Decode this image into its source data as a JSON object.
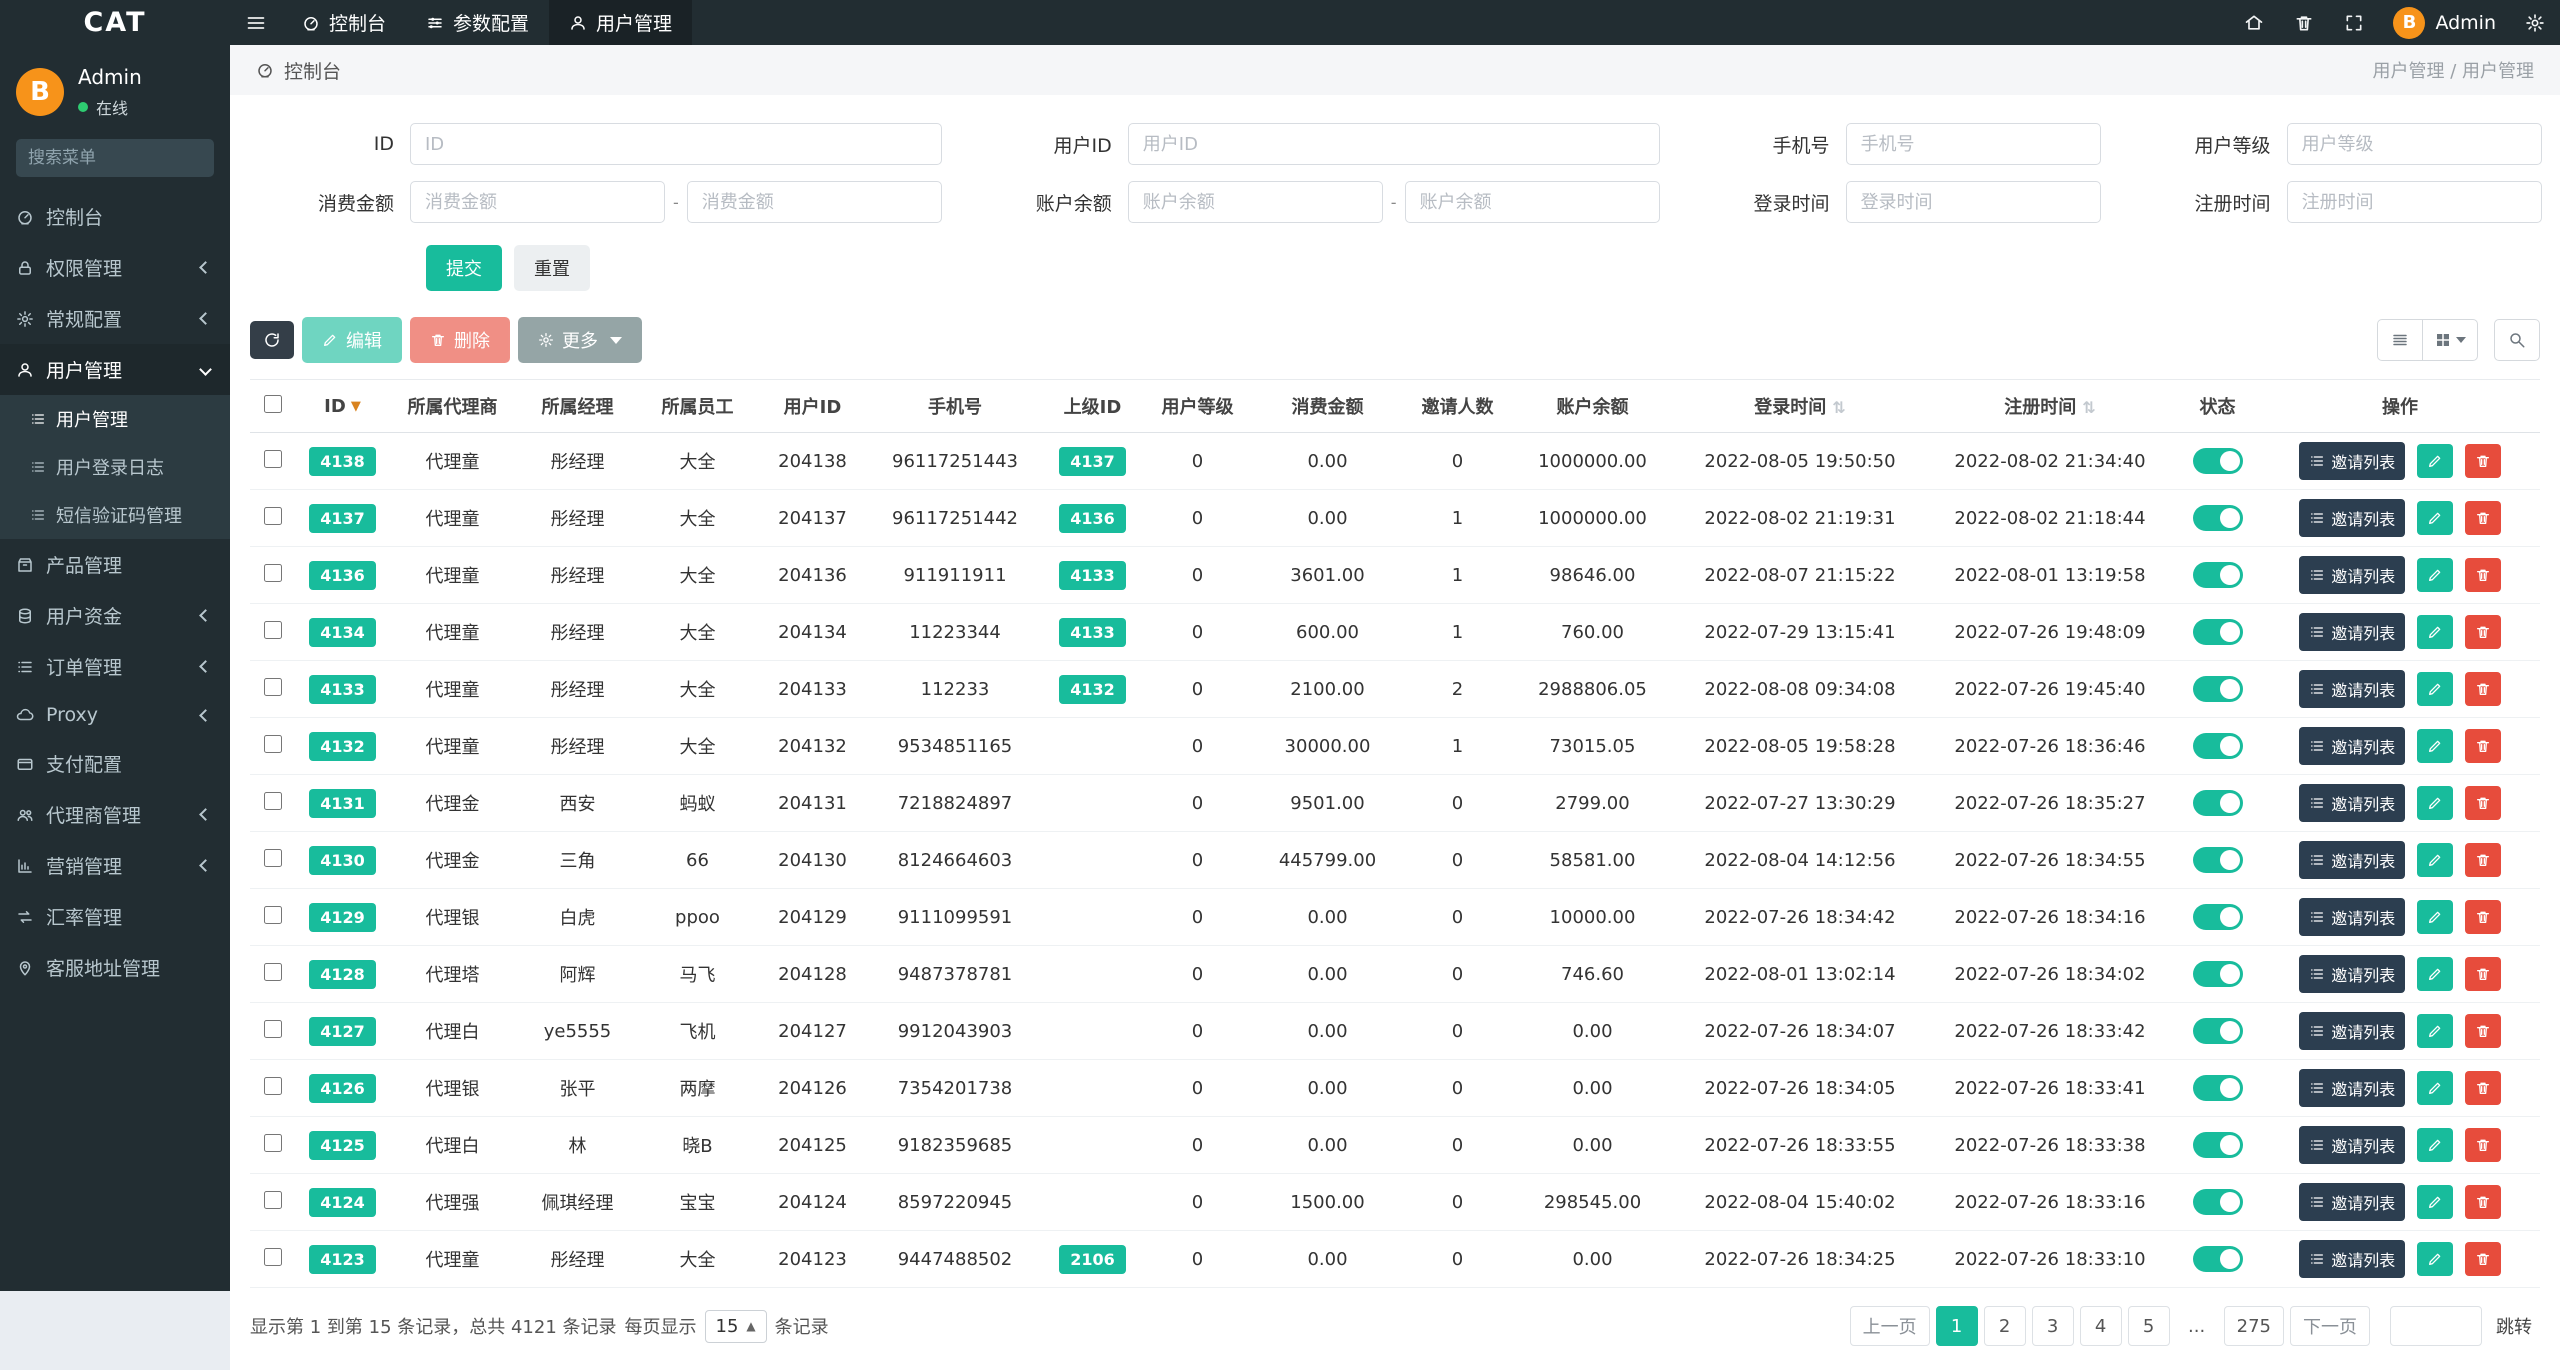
{
  "brand": "CAT",
  "topnav": {
    "items": [
      {
        "label": "控制台"
      },
      {
        "label": "参数配置"
      },
      {
        "label": "用户管理"
      }
    ],
    "admin_label": "Admin"
  },
  "sidebar": {
    "user_name": "Admin",
    "user_status": "在线",
    "avatar_letter": "B",
    "search_placeholder": "搜索菜单",
    "items": [
      {
        "label": "控制台",
        "icon": "gauge"
      },
      {
        "label": "权限管理",
        "icon": "lock",
        "arrow": "left"
      },
      {
        "label": "常规配置",
        "icon": "gear",
        "arrow": "left"
      },
      {
        "label": "用户管理",
        "icon": "user",
        "arrow": "down",
        "active": true,
        "children": [
          {
            "label": "用户管理",
            "active": true
          },
          {
            "label": "用户登录日志"
          },
          {
            "label": "短信验证码管理"
          }
        ]
      },
      {
        "label": "产品管理",
        "icon": "box"
      },
      {
        "label": "用户资金",
        "icon": "coins",
        "arrow": "left"
      },
      {
        "label": "订单管理",
        "icon": "list",
        "arrow": "left"
      },
      {
        "label": "Proxy",
        "icon": "cloud",
        "arrow": "left"
      },
      {
        "label": "支付配置",
        "icon": "card"
      },
      {
        "label": "代理商管理",
        "icon": "users",
        "arrow": "left"
      },
      {
        "label": "营销管理",
        "icon": "chart",
        "arrow": "left"
      },
      {
        "label": "汇率管理",
        "icon": "exchange"
      },
      {
        "label": "客服地址管理",
        "icon": "pin"
      }
    ]
  },
  "breadcrumb": {
    "left": "控制台",
    "right": "用户管理 / 用户管理"
  },
  "filters": {
    "row1": [
      {
        "label": "ID",
        "placeholder": "ID"
      },
      {
        "label": "用户ID",
        "placeholder": "用户ID"
      },
      {
        "label": "手机号",
        "placeholder": "手机号"
      },
      {
        "label": "用户等级",
        "placeholder": "用户等级"
      }
    ],
    "row2": [
      {
        "label": "消费金额",
        "placeholder": "消费金额"
      },
      {
        "label": "账户余额",
        "placeholder": "账户余额"
      },
      {
        "label": "登录时间",
        "placeholder": "登录时间"
      },
      {
        "label": "注册时间",
        "placeholder": "注册时间"
      }
    ],
    "submit_label": "提交",
    "reset_label": "重置"
  },
  "toolbar": {
    "edit_label": "编辑",
    "delete_label": "删除",
    "more_label": "更多"
  },
  "table": {
    "columns": [
      "ID",
      "所属代理商",
      "所属经理",
      "所属员工",
      "用户ID",
      "手机号",
      "上级ID",
      "用户等级",
      "消费金额",
      "邀请人数",
      "账户余额",
      "登录时间",
      "注册时间",
      "状态",
      "操作"
    ],
    "row_action_label": "邀请列表",
    "rows": [
      {
        "id": "4138",
        "agent": "代理童",
        "manager": "彤经理",
        "staff": "大全",
        "user_id": "204138",
        "phone": "96117251443",
        "parent_id": "4137",
        "level": "0",
        "consume": "0.00",
        "invites": "0",
        "balance": "1000000.00",
        "login_time": "2022-08-05 19:50:50",
        "reg_time": "2022-08-02 21:34:40"
      },
      {
        "id": "4137",
        "agent": "代理童",
        "manager": "彤经理",
        "staff": "大全",
        "user_id": "204137",
        "phone": "96117251442",
        "parent_id": "4136",
        "level": "0",
        "consume": "0.00",
        "invites": "1",
        "balance": "1000000.00",
        "login_time": "2022-08-02 21:19:31",
        "reg_time": "2022-08-02 21:18:44"
      },
      {
        "id": "4136",
        "agent": "代理童",
        "manager": "彤经理",
        "staff": "大全",
        "user_id": "204136",
        "phone": "911911911",
        "parent_id": "4133",
        "level": "0",
        "consume": "3601.00",
        "invites": "1",
        "balance": "98646.00",
        "login_time": "2022-08-07 21:15:22",
        "reg_time": "2022-08-01 13:19:58"
      },
      {
        "id": "4134",
        "agent": "代理童",
        "manager": "彤经理",
        "staff": "大全",
        "user_id": "204134",
        "phone": "11223344",
        "parent_id": "4133",
        "level": "0",
        "consume": "600.00",
        "invites": "1",
        "balance": "760.00",
        "login_time": "2022-07-29 13:15:41",
        "reg_time": "2022-07-26 19:48:09"
      },
      {
        "id": "4133",
        "agent": "代理童",
        "manager": "彤经理",
        "staff": "大全",
        "user_id": "204133",
        "phone": "112233",
        "parent_id": "4132",
        "level": "0",
        "consume": "2100.00",
        "invites": "2",
        "balance": "2988806.05",
        "login_time": "2022-08-08 09:34:08",
        "reg_time": "2022-07-26 19:45:40"
      },
      {
        "id": "4132",
        "agent": "代理童",
        "manager": "彤经理",
        "staff": "大全",
        "user_id": "204132",
        "phone": "9534851165",
        "parent_id": "",
        "level": "0",
        "consume": "30000.00",
        "invites": "1",
        "balance": "73015.05",
        "login_time": "2022-08-05 19:58:28",
        "reg_time": "2022-07-26 18:36:46"
      },
      {
        "id": "4131",
        "agent": "代理金",
        "manager": "西安",
        "staff": "蚂蚁",
        "user_id": "204131",
        "phone": "7218824897",
        "parent_id": "",
        "level": "0",
        "consume": "9501.00",
        "invites": "0",
        "balance": "2799.00",
        "login_time": "2022-07-27 13:30:29",
        "reg_time": "2022-07-26 18:35:27"
      },
      {
        "id": "4130",
        "agent": "代理金",
        "manager": "三角",
        "staff": "66",
        "user_id": "204130",
        "phone": "8124664603",
        "parent_id": "",
        "level": "0",
        "consume": "445799.00",
        "invites": "0",
        "balance": "58581.00",
        "login_time": "2022-08-04 14:12:56",
        "reg_time": "2022-07-26 18:34:55"
      },
      {
        "id": "4129",
        "agent": "代理银",
        "manager": "白虎",
        "staff": "ppoo",
        "user_id": "204129",
        "phone": "9111099591",
        "parent_id": "",
        "level": "0",
        "consume": "0.00",
        "invites": "0",
        "balance": "10000.00",
        "login_time": "2022-07-26 18:34:42",
        "reg_time": "2022-07-26 18:34:16"
      },
      {
        "id": "4128",
        "agent": "代理塔",
        "manager": "阿辉",
        "staff": "马飞",
        "user_id": "204128",
        "phone": "9487378781",
        "parent_id": "",
        "level": "0",
        "consume": "0.00",
        "invites": "0",
        "balance": "746.60",
        "login_time": "2022-08-01 13:02:14",
        "reg_time": "2022-07-26 18:34:02"
      },
      {
        "id": "4127",
        "agent": "代理白",
        "manager": "ye5555",
        "staff": "飞机",
        "user_id": "204127",
        "phone": "9912043903",
        "parent_id": "",
        "level": "0",
        "consume": "0.00",
        "invites": "0",
        "balance": "0.00",
        "login_time": "2022-07-26 18:34:07",
        "reg_time": "2022-07-26 18:33:42"
      },
      {
        "id": "4126",
        "agent": "代理银",
        "manager": "张平",
        "staff": "两摩",
        "user_id": "204126",
        "phone": "7354201738",
        "parent_id": "",
        "level": "0",
        "consume": "0.00",
        "invites": "0",
        "balance": "0.00",
        "login_time": "2022-07-26 18:34:05",
        "reg_time": "2022-07-26 18:33:41"
      },
      {
        "id": "4125",
        "agent": "代理白",
        "manager": "林",
        "staff": "晓B",
        "user_id": "204125",
        "phone": "9182359685",
        "parent_id": "",
        "level": "0",
        "consume": "0.00",
        "invites": "0",
        "balance": "0.00",
        "login_time": "2022-07-26 18:33:55",
        "reg_time": "2022-07-26 18:33:38"
      },
      {
        "id": "4124",
        "agent": "代理强",
        "manager": "佩琪经理",
        "staff": "宝宝",
        "user_id": "204124",
        "phone": "8597220945",
        "parent_id": "",
        "level": "0",
        "consume": "1500.00",
        "invites": "0",
        "balance": "298545.00",
        "login_time": "2022-08-04 15:40:02",
        "reg_time": "2022-07-26 18:33:16"
      },
      {
        "id": "4123",
        "agent": "代理童",
        "manager": "彤经理",
        "staff": "大全",
        "user_id": "204123",
        "phone": "9447488502",
        "parent_id": "2106",
        "level": "0",
        "consume": "0.00",
        "invites": "0",
        "balance": "0.00",
        "login_time": "2022-07-26 18:34:25",
        "reg_time": "2022-07-26 18:33:10"
      }
    ]
  },
  "footer": {
    "info": "显示第 1 到第 15 条记录，总共 4121 条记录",
    "per_page_label": "每页显示",
    "per_page_value": "15",
    "per_page_suffix": "条记录",
    "pagination": {
      "prev": "上一页",
      "pages": [
        "1",
        "2",
        "3",
        "4",
        "5",
        "...",
        "275"
      ],
      "active": "1",
      "next": "下一页",
      "jump_label": "跳转"
    }
  },
  "colors": {
    "accent": "#18bc9c",
    "danger": "#e74c3c",
    "navy": "#2c3e50",
    "sidebar": "#222d32"
  }
}
